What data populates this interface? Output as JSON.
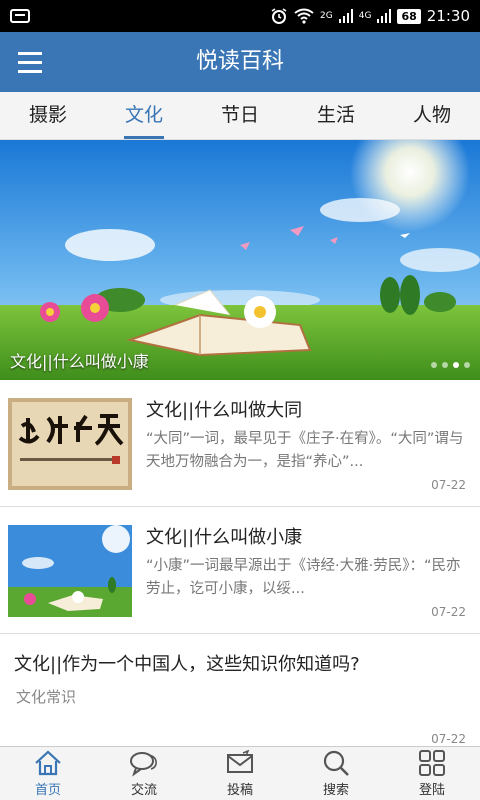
{
  "status_bar": {
    "network_label": "2G",
    "network_label2": "4G",
    "battery": "68",
    "time": "21:30"
  },
  "header": {
    "title": "悦读百科"
  },
  "tabs": [
    {
      "label": "摄影"
    },
    {
      "label": "文化",
      "active": true
    },
    {
      "label": "节日"
    },
    {
      "label": "生活"
    },
    {
      "label": "人物"
    }
  ],
  "banner": {
    "caption": "文化||什么叫做小康",
    "slides": 4,
    "active_slide": 2
  },
  "news": [
    {
      "title": "文化||什么叫做大同",
      "summary": "“大同”一词，最早见于《庄子·在宥》。“大同”谓与天地万物融合为一，是指“养心”...",
      "date": "07-22"
    },
    {
      "title": "文化||什么叫做小康",
      "summary": "“小康”一词最早源出于《诗经·大雅·劳民》：“民亦劳止，讫可小康，以绥...",
      "date": "07-22"
    },
    {
      "title": "文化||作为一个中国人，这些知识你知道吗?",
      "category": "文化常识",
      "date": "07-22"
    }
  ],
  "bottom_nav": [
    {
      "label": "首页",
      "icon": "home-icon",
      "active": true
    },
    {
      "label": "交流",
      "icon": "chat-icon"
    },
    {
      "label": "投稿",
      "icon": "mail-icon"
    },
    {
      "label": "搜索",
      "icon": "search-icon"
    },
    {
      "label": "登陆",
      "icon": "grid-icon"
    }
  ],
  "colors": {
    "primary": "#3a76b5",
    "tab_bg": "#f4f4f4"
  }
}
